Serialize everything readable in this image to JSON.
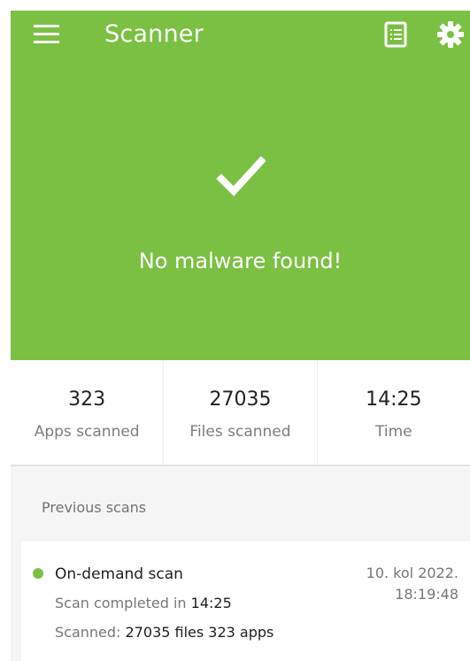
{
  "app": {
    "title": "Scanner",
    "status": "No malware found!"
  },
  "icons": {
    "menu": "menu-icon",
    "history": "scan-history-icon",
    "settings": "gear-icon",
    "status": "checkmark-icon",
    "scan_status": "green-dot-icon"
  },
  "colors": {
    "accent": "#7cc043",
    "background": "#f5f5f5",
    "card": "#ffffff",
    "primary_text": "#202020",
    "secondary_text": "#777777"
  },
  "stats": [
    {
      "value": "323",
      "label": "Apps scanned"
    },
    {
      "value": "27035",
      "label": "Files scanned"
    },
    {
      "value": "14:25",
      "label": "Time"
    }
  ],
  "previous_scans": {
    "heading": "Previous scans",
    "items": [
      {
        "type": "On-demand scan",
        "completed_prefix": "Scan completed in",
        "completed_time": "14:25",
        "scanned_prefix": "Scanned:",
        "scanned_summary": "27035 files 323 apps",
        "date": "10. kol 2022.",
        "time": "18:19:48"
      }
    ]
  }
}
